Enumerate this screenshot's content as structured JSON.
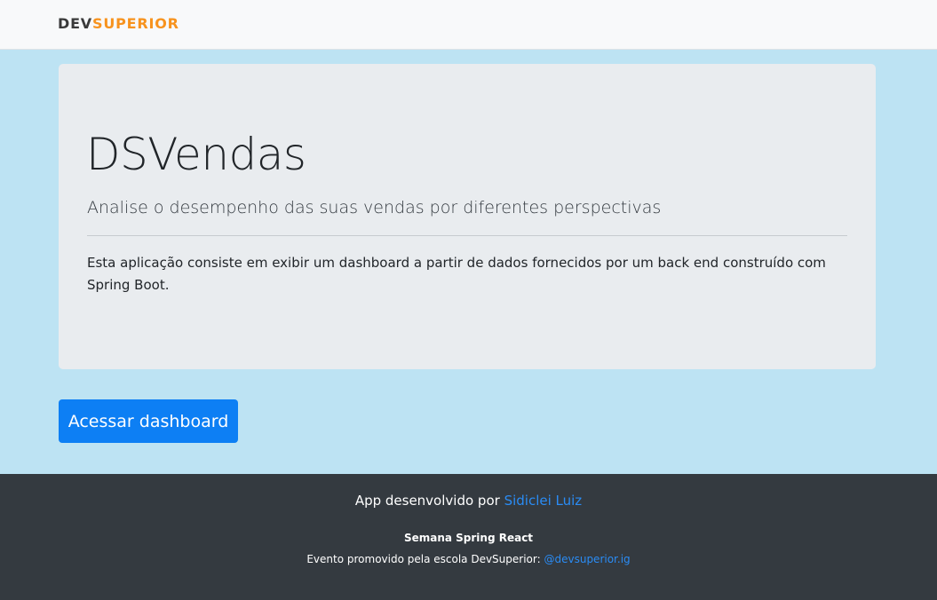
{
  "navbar": {
    "logo_dev": "DEV",
    "logo_superior": "SUPERIOR"
  },
  "jumbotron": {
    "title": "DSVendas",
    "lead": "Analise o desempenho das suas vendas por diferentes perspectivas",
    "description": "Esta aplicação consiste em exibir um dashboard a partir de dados fornecidos por um back end construído com Spring Boot."
  },
  "actions": {
    "dashboard_button": "Acessar dashboard"
  },
  "footer": {
    "developed_by": "App desenvolvido por",
    "author": "Sidiclei Luiz",
    "event_name": "Semana Spring React",
    "promoted_by": "Evento promovido pela escola DevSuperior:",
    "instagram": "@devsuperior.ig"
  },
  "colors": {
    "brand_orange": "#f7931e",
    "primary_blue": "#0d7ff4",
    "page_background": "#bde3f3",
    "footer_background": "#343a40"
  }
}
